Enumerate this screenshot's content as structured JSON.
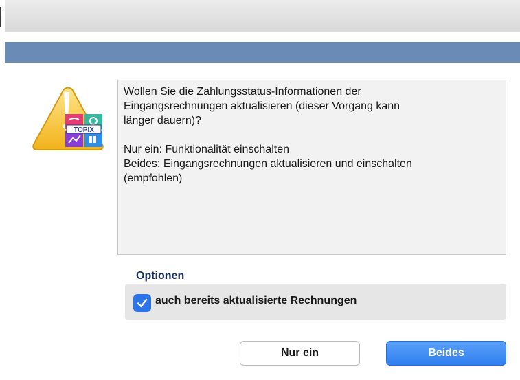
{
  "dialog": {
    "message_lines": [
      "Wollen Sie die Zahlungsstatus-Informationen der",
      "Eingangsrechnungen aktualisieren (dieser Vorgang kann",
      "länger dauern)?",
      "",
      "Nur ein: Funktionalität einschalten",
      "Beides: Eingangsrechnungen aktualisieren und einschalten",
      "(empfohlen)"
    ],
    "icon": {
      "name": "warning-topix-icon",
      "brand_text": "TOPIX"
    }
  },
  "options": {
    "heading": "Optionen",
    "checkbox": {
      "label": "auch bereits aktualisierte Rechnungen",
      "checked": true
    }
  },
  "buttons": {
    "secondary": "Nur ein",
    "primary": "Beides"
  },
  "colors": {
    "header_band": "#6a8bb6",
    "primary_button": "#2f7ff0",
    "checkbox": "#2d73e8",
    "options_heading": "#1c2e5c"
  }
}
